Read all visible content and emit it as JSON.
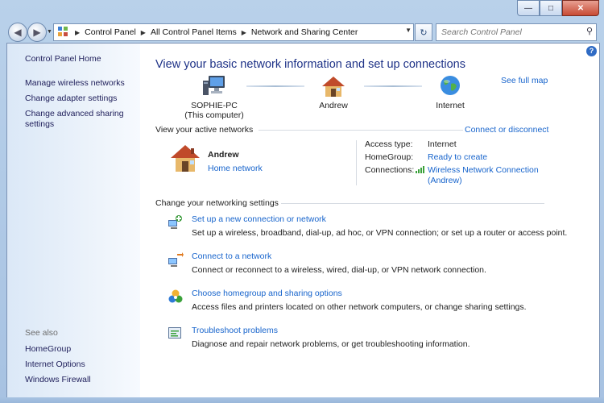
{
  "titlebar": {
    "minimize_icon": "minimize-icon",
    "maximize_icon": "maximize-icon",
    "close_icon": "close-icon"
  },
  "address": {
    "segments": [
      "Control Panel",
      "All Control Panel Items",
      "Network and Sharing Center"
    ]
  },
  "search": {
    "placeholder": "Search Control Panel"
  },
  "sidebar": {
    "home": "Control Panel Home",
    "links": [
      "Manage wireless networks",
      "Change adapter settings",
      "Change advanced sharing settings"
    ],
    "see_also_label": "See also",
    "see_also": [
      "HomeGroup",
      "Internet Options",
      "Windows Firewall"
    ]
  },
  "main": {
    "title": "View your basic network information and set up connections",
    "see_full_map": "See full map",
    "map": {
      "computer_name": "SOPHIE-PC",
      "computer_sub": "(This computer)",
      "network": "Andrew",
      "internet": "Internet"
    },
    "active_networks": {
      "heading": "View your active networks",
      "connect_link": "Connect or disconnect",
      "name": "Andrew",
      "type": "Home network",
      "access_type_label": "Access type:",
      "access_type_value": "Internet",
      "homegroup_label": "HomeGroup:",
      "homegroup_value": "Ready to create",
      "connections_label": "Connections:",
      "connections_value_1": "Wireless Network Connection",
      "connections_value_2": "(Andrew)"
    },
    "settings": {
      "heading": "Change your networking settings",
      "tasks": [
        {
          "title": "Set up a new connection or network",
          "desc": "Set up a wireless, broadband, dial-up, ad hoc, or VPN connection; or set up a router or access point."
        },
        {
          "title": "Connect to a network",
          "desc": "Connect or reconnect to a wireless, wired, dial-up, or VPN network connection."
        },
        {
          "title": "Choose homegroup and sharing options",
          "desc": "Access files and printers located on other network computers, or change sharing settings."
        },
        {
          "title": "Troubleshoot problems",
          "desc": "Diagnose and repair network problems, or get troubleshooting information."
        }
      ]
    }
  },
  "colors": {
    "link": "#1764cc",
    "title": "#1e3287",
    "sidebar_text": "#1e1e5a"
  }
}
